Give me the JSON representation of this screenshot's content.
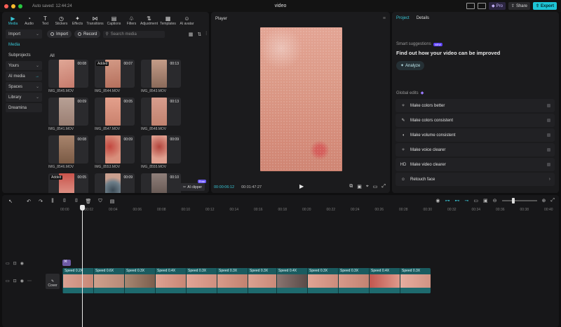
{
  "window": {
    "autosave": "Auto saved: 12:44:24",
    "title": "video"
  },
  "topbar": {
    "pro_label": "Pro",
    "share_label": "Share",
    "export_label": "Export"
  },
  "toolbar_tabs": [
    {
      "label": "Media",
      "icon": "media-icon"
    },
    {
      "label": "Audio",
      "icon": "audio-icon"
    },
    {
      "label": "Text",
      "icon": "text-icon"
    },
    {
      "label": "Stickers",
      "icon": "stickers-icon"
    },
    {
      "label": "Effects",
      "icon": "effects-icon"
    },
    {
      "label": "Transitions",
      "icon": "transitions-icon"
    },
    {
      "label": "Captions",
      "icon": "captions-icon"
    },
    {
      "label": "Filters",
      "icon": "filters-icon"
    },
    {
      "label": "Adjustment",
      "icon": "adjustment-icon"
    },
    {
      "label": "Templates",
      "icon": "templates-icon"
    },
    {
      "label": "AI avatar",
      "icon": "ai-avatar-icon"
    }
  ],
  "sidebar": {
    "items": [
      {
        "label": "Import"
      },
      {
        "label": "Media"
      },
      {
        "label": "Subprojects"
      },
      {
        "label": "Yours"
      },
      {
        "label": "AI media"
      },
      {
        "label": "Spaces"
      },
      {
        "label": "Library"
      },
      {
        "label": "Dreamina"
      }
    ]
  },
  "media_toolbar": {
    "import_label": "Import",
    "record_label": "Record",
    "search_placeholder": "Search media"
  },
  "media": {
    "filter_label": "All",
    "items": [
      {
        "name": "IMG_8545.MOV",
        "duration": "00:08",
        "added": ""
      },
      {
        "name": "IMG_8544.MOV",
        "duration": "00:07",
        "added": "Added"
      },
      {
        "name": "IMG_8543.MOV",
        "duration": "00:13",
        "added": ""
      },
      {
        "name": "IMG_8541.MOV",
        "duration": "00:09",
        "added": ""
      },
      {
        "name": "IMG_8547.MOV",
        "duration": "00:05",
        "added": ""
      },
      {
        "name": "IMG_8548.MOV",
        "duration": "00:13",
        "added": ""
      },
      {
        "name": "IMG_8546.MOV",
        "duration": "00:08",
        "added": ""
      },
      {
        "name": "IMG_8553.MOV",
        "duration": "00:09",
        "added": ""
      },
      {
        "name": "IMG_8555.MOV",
        "duration": "00:09",
        "added": ""
      },
      {
        "name": "",
        "duration": "00:05",
        "added": "Added"
      },
      {
        "name": "",
        "duration": "00:09",
        "added": ""
      },
      {
        "name": "",
        "duration": "00:10",
        "added": ""
      }
    ],
    "ai_clipper_label": "AI clipper",
    "ai_clipper_badge": "Free"
  },
  "player": {
    "title": "Player",
    "current_time": "00:00:06:12",
    "total_time": "00:01:47:27"
  },
  "properties": {
    "tabs": [
      "Project",
      "Details"
    ],
    "smart_label": "Smart suggestions",
    "smart_badge": "NEW",
    "smart_title": "Find out how your video can be improved",
    "analyze_label": "Analyze",
    "global_label": "Global edits",
    "global_edits": [
      {
        "label": "Make colors better",
        "icon": "magic-wand-icon"
      },
      {
        "label": "Make colors consistent",
        "icon": "palette-icon"
      },
      {
        "label": "Make volume consistent",
        "icon": "volume-icon"
      },
      {
        "label": "Make voice clearer",
        "icon": "voice-icon"
      },
      {
        "label": "Make video clearer",
        "icon": "hd-icon",
        "glyph": "HD"
      },
      {
        "label": "Retouch face",
        "icon": "face-icon"
      }
    ]
  },
  "timeline": {
    "ruler": [
      "00:00",
      "00:02",
      "00:04",
      "00:06",
      "00:08",
      "00:10",
      "00:12",
      "00:14",
      "00:16",
      "00:18",
      "00:20",
      "00:22",
      "00:24",
      "00:26",
      "00:28",
      "00:30",
      "00:32",
      "00:34",
      "00:36",
      "00:38",
      "00:40"
    ],
    "cover_label": "Cover",
    "clips": [
      {
        "label": "Speed 0.2X"
      },
      {
        "label": "Speed 0.6X"
      },
      {
        "label": "Speed 0.3X"
      },
      {
        "label": "Speed 0.4X"
      },
      {
        "label": "Speed 0.3X"
      },
      {
        "label": "Speed 0.3X"
      },
      {
        "label": "Speed 0.3X"
      },
      {
        "label": "Speed 0.4X"
      },
      {
        "label": "Speed 0.3X"
      },
      {
        "label": "Speed 0.3X"
      },
      {
        "label": "Speed 0.4X"
      },
      {
        "label": "Speed 0.3X"
      }
    ]
  },
  "colors": {
    "accent": "#38c6d6",
    "clip_track": "#1a5c60",
    "skin": "#d99583",
    "panel": "#1b1b1d"
  }
}
